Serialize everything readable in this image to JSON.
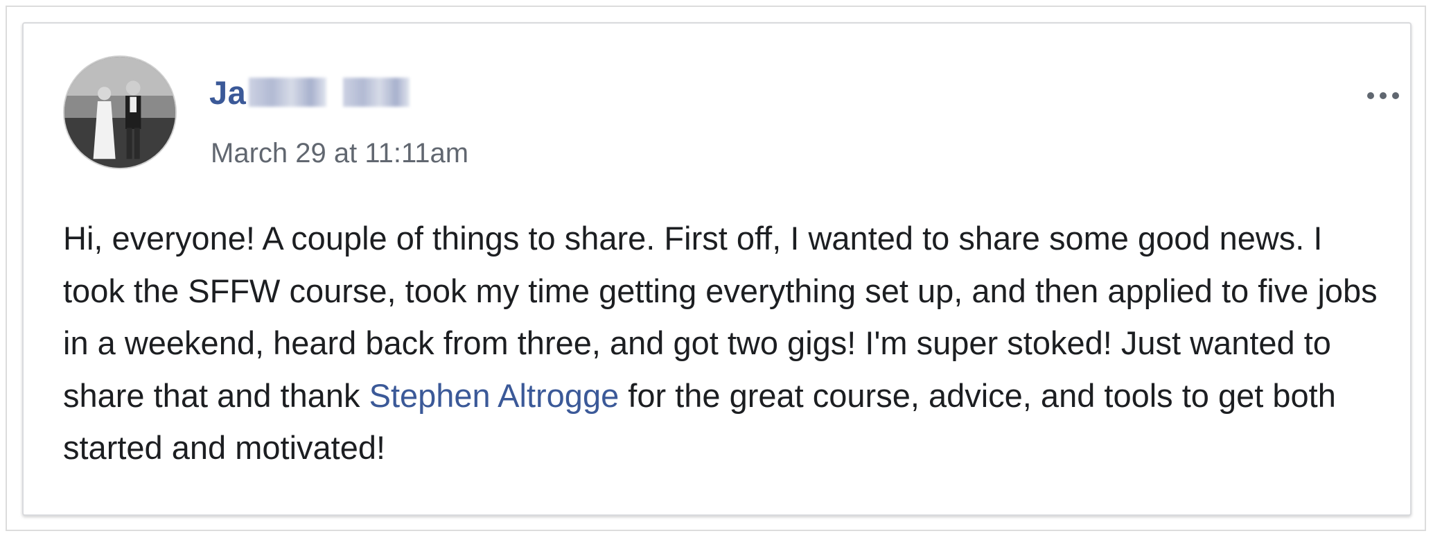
{
  "post": {
    "author": {
      "name_visible": "Ja",
      "name_blurred": true
    },
    "timestamp": "March 29 at 11:11am",
    "menu_icon": "more-horizontal-icon",
    "body": {
      "before_mention": "Hi, everyone! A couple of things to share. First off, I wanted to share some good news. I took the SFFW course, took my time getting everything set up, and then applied to five jobs in a weekend, heard back from three, and got two gigs! I'm super stoked! Just wanted to share that and thank ",
      "mention": "Stephen Altrogge",
      "after_mention": " for the great course, advice, and tools to get both started and motivated!"
    }
  },
  "colors": {
    "link_blue": "#3b5998",
    "timestamp_gray": "#616770",
    "body_text": "#1c1e21"
  }
}
